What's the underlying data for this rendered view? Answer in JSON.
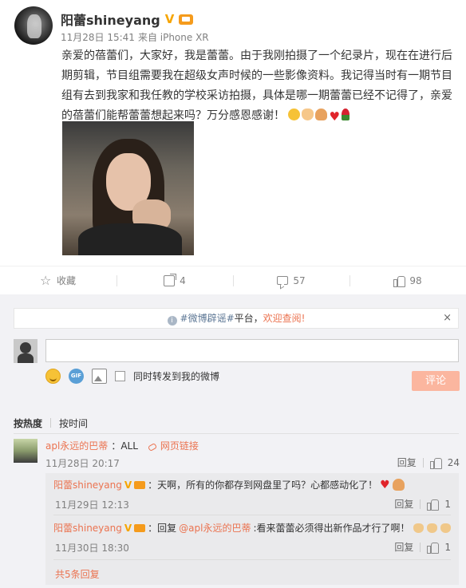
{
  "post": {
    "author": "阳蕾shineyang",
    "verified_mark": "V",
    "time": "11月28日 15:41",
    "source": "来自 iPhone XR",
    "text": "亲爱的蓓蕾们，大家好，我是蕾蕾。由于我刚拍摄了一个纪录片，现在在进行后期剪辑，节目组需要我在超级女声时候的一些影像资料。我记得当时有一期节目组有去到我家和我任教的学校采访拍摄，具体是哪一期蕾蕾已经不记得了，亲爱的蓓蕾们能帮蕾蕾想起来吗？万分感恩感谢！",
    "emoji": [
      "smile-emoji",
      "clap-emoji",
      "pray-emoji",
      "heart-emoji",
      "rose-emoji"
    ]
  },
  "actions": {
    "favorite_label": "收藏",
    "share_count": "4",
    "comment_count": "57",
    "like_count": "98"
  },
  "notice": {
    "tag": "#微博辟谣#",
    "middle": "平台，",
    "link": "欢迎查阅!",
    "info_icon": "i",
    "close": "×"
  },
  "composer": {
    "input_value": "",
    "gif_label": "GIF",
    "forward_label": "同时转发到我的微博",
    "submit_label": "评论"
  },
  "sort": {
    "by_hot": "按热度",
    "by_time": "按时间"
  },
  "comment": {
    "user": "apl永远的巴蒂",
    "text": "：ALL",
    "link_label": "网页链接",
    "time": "11月28日 20:17",
    "reply_label": "回复",
    "like_count": "24"
  },
  "replies": [
    {
      "user": "阳蕾shineyang",
      "verified_mark": "V",
      "text": "：天啊，所有的你都存到网盘里了吗？心都感动化了！",
      "time": "11月29日 12:13",
      "reply_label": "回复",
      "like_count": "1"
    },
    {
      "user": "阳蕾shineyang",
      "verified_mark": "V",
      "prefix": "：回复",
      "mention": "@apl永远的巴蒂",
      "text": ":看来蕾蕾必须得出新作品才行了啊！",
      "time": "11月30日 18:30",
      "reply_label": "回复",
      "like_count": "1"
    }
  ],
  "more_replies": "共5条回复",
  "colors": {
    "accent": "#eb7350",
    "submit_button": "#fbb69f",
    "verified": "#f6a500",
    "comment_bg": "#f2f2f5"
  }
}
